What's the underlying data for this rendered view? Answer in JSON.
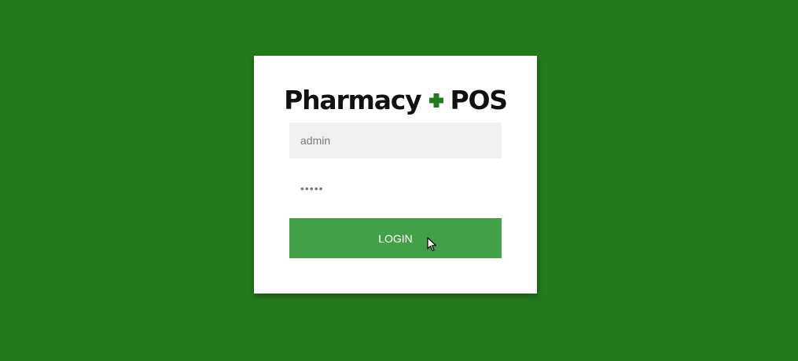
{
  "logo": {
    "text_left": "Pharmacy",
    "text_right": "POS",
    "cross_color": "#237a1d"
  },
  "login": {
    "username_value": "admin",
    "password_value": "•••••",
    "button_label": "LOGIN"
  },
  "colors": {
    "background": "#237a1d",
    "button": "#44a048",
    "card": "#ffffff"
  }
}
